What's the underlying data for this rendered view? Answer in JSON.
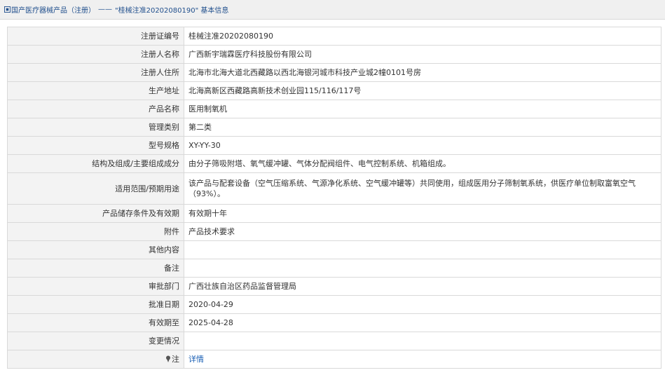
{
  "breadcrumb": {
    "home_label": "国产医疗器械产品（注册）",
    "separator": "——",
    "current": "\"桂械注准20202080190\" 基本信息"
  },
  "rows": [
    {
      "label": "注册证编号",
      "value": "桂械注准20202080190"
    },
    {
      "label": "注册人名称",
      "value": "广西新宇瑞霖医疗科技股份有限公司"
    },
    {
      "label": "注册人住所",
      "value": "北海市北海大道北西藏路以西北海银河城市科技产业城2幢0101号房"
    },
    {
      "label": "生产地址",
      "value": "北海高新区西藏路高新技术创业园115/116/117号"
    },
    {
      "label": "产品名称",
      "value": "医用制氧机"
    },
    {
      "label": "管理类别",
      "value": "第二类"
    },
    {
      "label": "型号规格",
      "value": "XY-YY-30"
    },
    {
      "label": "结构及组成/主要组成成分",
      "value": "由分子筛吸附塔、氧气缓冲罐、气体分配阀组件、电气控制系统、机箱组成。"
    },
    {
      "label": "适用范围/预期用途",
      "value": "该产品与配套设备（空气压缩系统、气源净化系统、空气缓冲罐等）共同使用，组成医用分子筛制氧系统，供医疗单位制取富氧空气（93%）。"
    },
    {
      "label": "产品储存条件及有效期",
      "value": "有效期十年"
    },
    {
      "label": "附件",
      "value": "产品技术要求"
    },
    {
      "label": "其他内容",
      "value": ""
    },
    {
      "label": "备注",
      "value": ""
    },
    {
      "label": "审批部门",
      "value": "广西壮族自治区药品监督管理局"
    },
    {
      "label": "批准日期",
      "value": "2020-04-29"
    },
    {
      "label": "有效期至",
      "value": "2025-04-28"
    },
    {
      "label": "变更情况",
      "value": ""
    }
  ],
  "note_row": {
    "label": "注",
    "link_text": "详情"
  },
  "colors": {
    "link": "#1a5fb4",
    "label_bg": "#f3f3f3",
    "border": "#d9d9d9"
  }
}
